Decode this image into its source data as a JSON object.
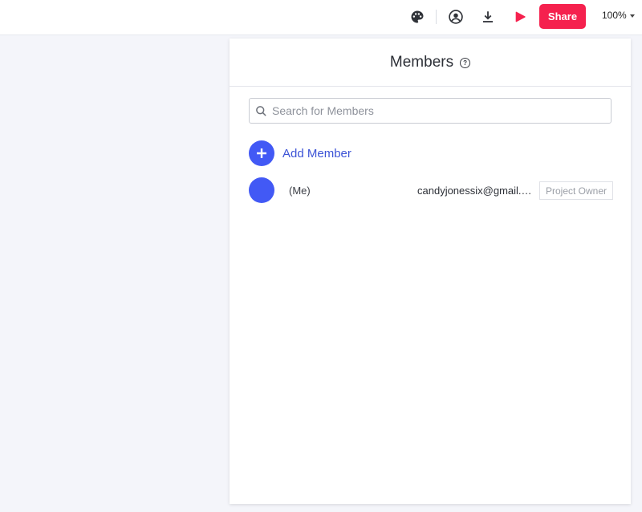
{
  "toolbar": {
    "icons": [
      "palette-icon",
      "user-circle-icon",
      "download-icon",
      "play-icon"
    ],
    "share_label": "Share",
    "zoom_label": "100%"
  },
  "panel": {
    "title": "Members",
    "search": {
      "placeholder": "Search for Members",
      "value": ""
    },
    "add_member_label": "Add Member",
    "members": [
      {
        "name": "(Me)",
        "email": "candyjonessix@gmail.com",
        "role": "Project Owner"
      }
    ]
  },
  "colors": {
    "accent": "#4259f5",
    "share": "#f5214e",
    "background": "#f4f5fa"
  }
}
